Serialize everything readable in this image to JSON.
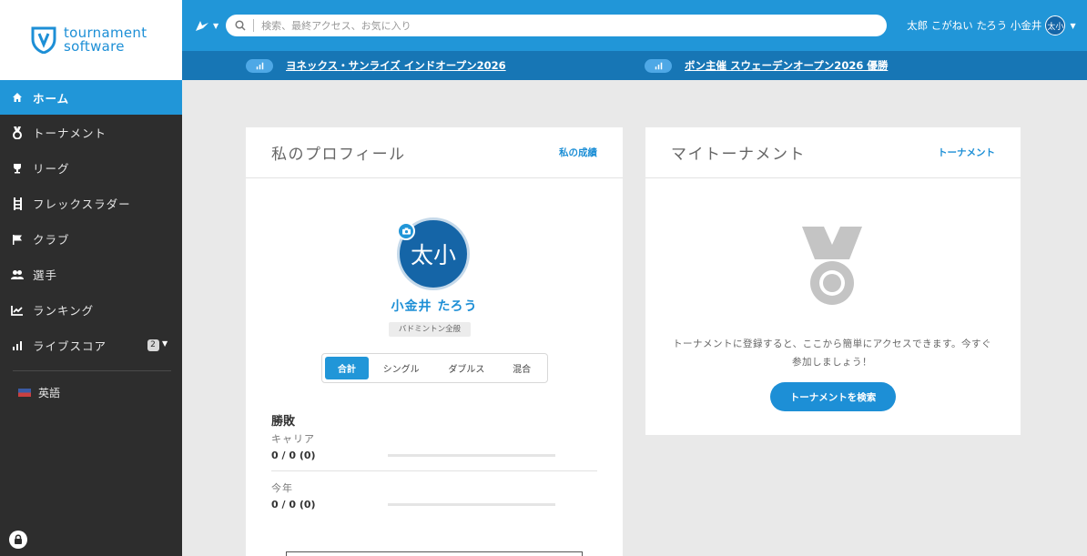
{
  "logo": {
    "line1": "tournament",
    "line2": "software"
  },
  "sidebar": {
    "items": [
      {
        "label": "ホーム",
        "icon": "home-icon"
      },
      {
        "label": "トーナメント",
        "icon": "medal-icon"
      },
      {
        "label": "リーグ",
        "icon": "trophy-icon"
      },
      {
        "label": "フレックスラダー",
        "icon": "ladder-icon"
      },
      {
        "label": "クラブ",
        "icon": "flag-icon"
      },
      {
        "label": "選手",
        "icon": "players-icon"
      },
      {
        "label": "ランキング",
        "icon": "chart-icon"
      },
      {
        "label": "ライブスコア",
        "icon": "live-icon",
        "badge": "2"
      }
    ],
    "language": "英語"
  },
  "search": {
    "placeholder": "検索、最終アクセス、お気に入り"
  },
  "user": {
    "name": "太郎 こがねい たろう 小金井",
    "initials": "太小"
  },
  "live_tournaments": [
    {
      "name": "ヨネックス・サンライズ インドオープン2026"
    },
    {
      "name": "ボン主催 スウェーデンオープン2026 優勝"
    }
  ],
  "profile": {
    "title": "私のプロフィール",
    "link": "私の成績",
    "avatar_text": "太小",
    "name": "小金井 たろう",
    "tag": "バドミントン全般",
    "tabs": [
      "合計",
      "シングル",
      "ダブルス",
      "混合"
    ],
    "stats_title": "勝敗",
    "career_label": "キャリア",
    "career_value": "0 / 0 (0)",
    "year_label": "今年",
    "year_value": "0 / 0 (0)"
  },
  "tournaments_card": {
    "title": "マイトーナメント",
    "link": "トーナメント",
    "empty_text": "トーナメントに登録すると、ここから簡単にアクセスできます。今すぐ参加しましょう！",
    "button": "トーナメントを検索"
  },
  "colors": {
    "accent": "#2196d8",
    "dark_accent": "#1776b5",
    "sidebar": "#2d2d2d"
  }
}
